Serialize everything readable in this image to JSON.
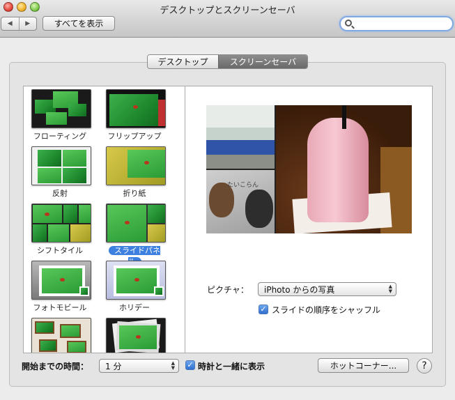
{
  "window": {
    "title": "デスクトップとスクリーンセーバ"
  },
  "toolbar": {
    "back_icon": "◀",
    "forward_icon": "▶",
    "show_all_label": "すべてを表示",
    "search": {
      "value": "",
      "placeholder": ""
    }
  },
  "tabs": [
    {
      "label": "デスクトップ",
      "selected": false
    },
    {
      "label": "スクリーンセーバ",
      "selected": true
    }
  ],
  "modules": [
    {
      "label": "フローティング"
    },
    {
      "label": "フリップアップ"
    },
    {
      "label": "反射"
    },
    {
      "label": "折り紙"
    },
    {
      "label": "シフトタイル"
    },
    {
      "label": "スライドパネル",
      "selected": true
    },
    {
      "label": "フォトモビール"
    },
    {
      "label": "ホリデー"
    },
    {
      "label": ""
    },
    {
      "label": ""
    }
  ],
  "options": {
    "picture_label": "ピクチャ：",
    "picture_value": "iPhoto からの写真",
    "shuffle_label": "スライドの順序をシャッフル",
    "shuffle_checked": true
  },
  "footer": {
    "start_label": "開始までの時間：",
    "start_value": "1 分",
    "clock_label": "時計と一緒に表示",
    "clock_checked": true,
    "hot_corners_label": "ホットコーナー...",
    "help_label": "?"
  },
  "preview": {
    "photo_caption": "たいこらん"
  },
  "colors": {
    "selection": "#3d80df",
    "checkbox": "#2f6fd0"
  }
}
